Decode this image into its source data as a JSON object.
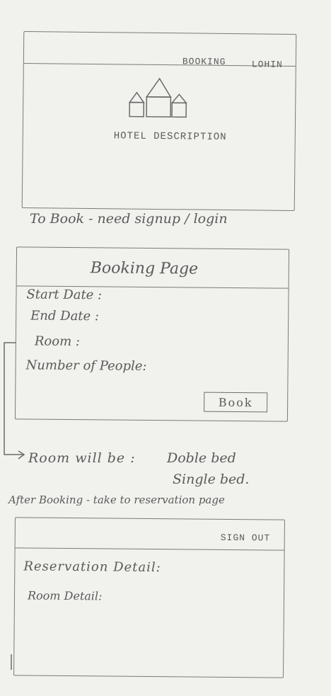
{
  "home_page": {
    "nav": {
      "booking_label": "BOOKING",
      "login_label": "LOHIN"
    },
    "hotel_description": "HOTEL DESCRIPTION"
  },
  "note_signup": "To Book - need signup / login",
  "booking_page": {
    "title": "Booking Page",
    "fields": [
      {
        "label": "Start Date :"
      },
      {
        "label": "End Date :"
      },
      {
        "label": "Room :"
      },
      {
        "label": "Number of People:"
      }
    ],
    "book_button": "Book"
  },
  "room_note": {
    "prefix": "Room will be :",
    "options": [
      "Doble bed",
      "Single bed."
    ]
  },
  "after_booking_note": "After Booking - take to reservation page",
  "reservation_page": {
    "sign_out_label": "SIGN OUT",
    "reservation_detail_label": "Reservation Detail:",
    "room_detail_label": "Room Detail:"
  }
}
